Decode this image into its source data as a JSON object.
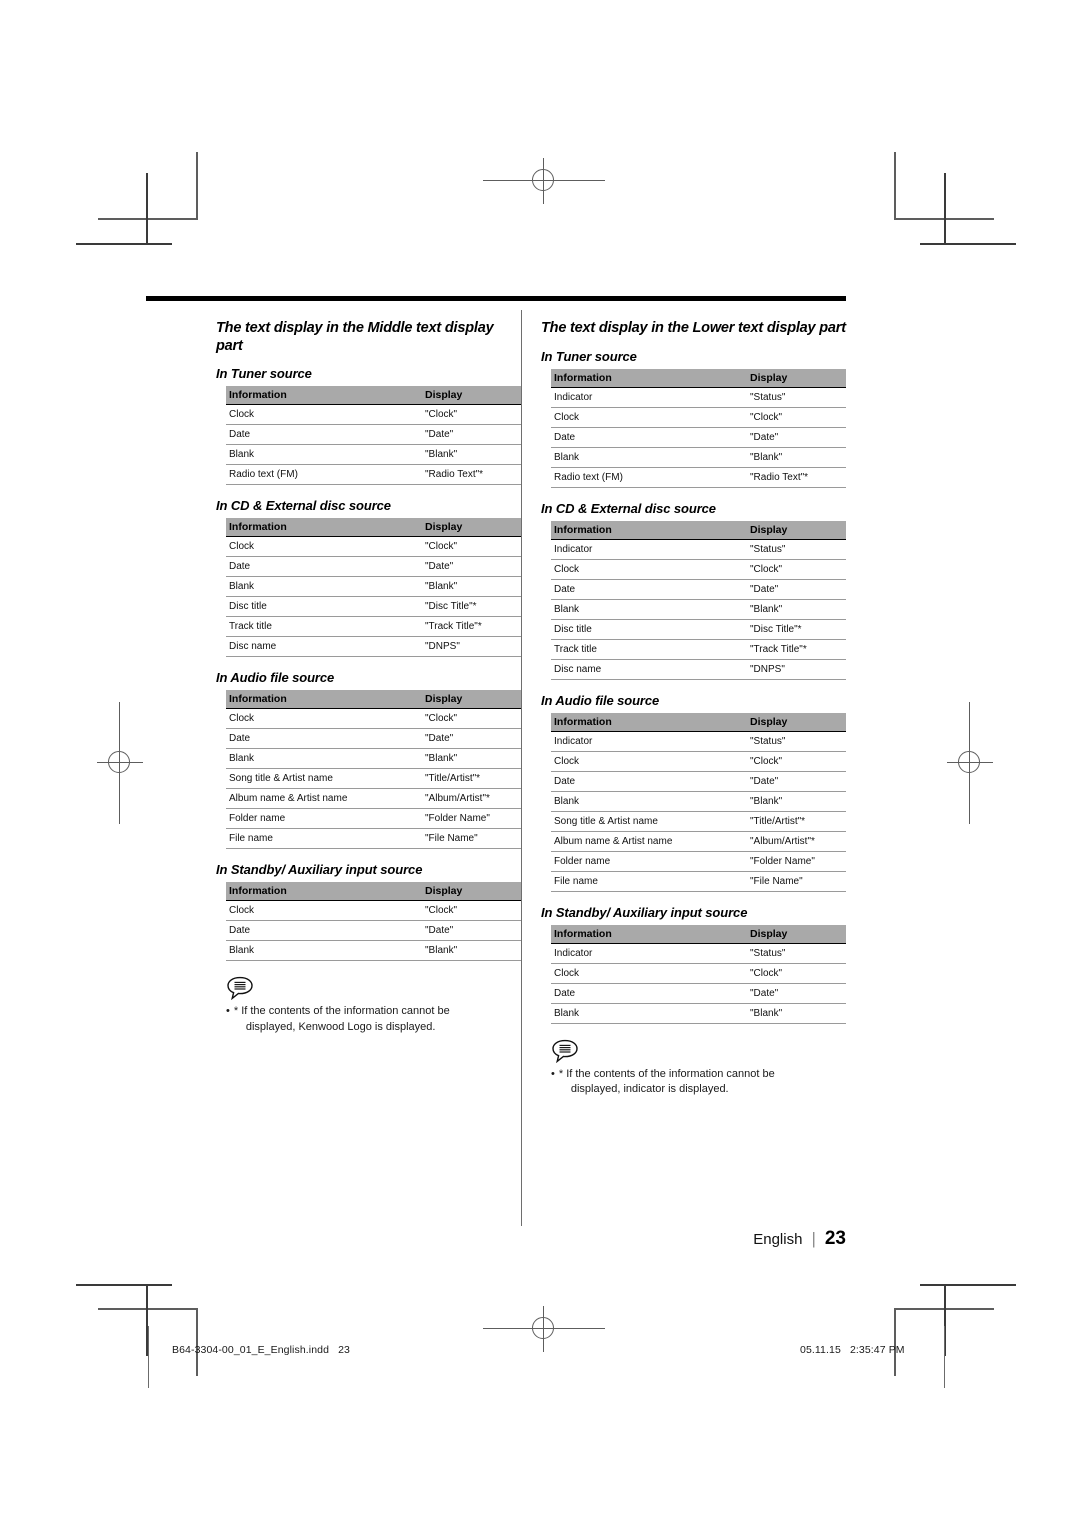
{
  "document": {
    "page_number": "23",
    "language_label": "English",
    "separator": "|"
  },
  "top_rule": true,
  "columns": [
    {
      "id": "middle-text-display",
      "section_title": "The text display in the Middle text display part",
      "blocks": [
        {
          "id": "tuner",
          "heading": "In Tuner source",
          "table": {
            "headers": [
              "Information",
              "Display"
            ],
            "rows": [
              [
                "Clock",
                "\"Clock\""
              ],
              [
                "Date",
                "\"Date\""
              ],
              [
                "Blank",
                "\"Blank\""
              ],
              [
                "Radio text (FM)",
                "\"Radio Text\"*"
              ]
            ]
          }
        },
        {
          "id": "cd-external-disc",
          "heading": "In CD & External disc source",
          "table": {
            "headers": [
              "Information",
              "Display"
            ],
            "rows": [
              [
                "Clock",
                "\"Clock\""
              ],
              [
                "Date",
                "\"Date\""
              ],
              [
                "Blank",
                "\"Blank\""
              ],
              [
                "Disc title",
                "\"Disc Title\"*"
              ],
              [
                "Track title",
                "\"Track Title\"*"
              ],
              [
                "Disc name",
                "\"DNPS\""
              ]
            ]
          }
        },
        {
          "id": "audio-file",
          "heading": "In Audio file source",
          "table": {
            "headers": [
              "Information",
              "Display"
            ],
            "rows": [
              [
                "Clock",
                "\"Clock\""
              ],
              [
                "Date",
                "\"Date\""
              ],
              [
                "Blank",
                "\"Blank\""
              ],
              [
                "Song title & Artist name",
                "\"Title/Artist\"*"
              ],
              [
                "Album name & Artist name",
                "\"Album/Artist\"*"
              ],
              [
                "Folder name",
                "\"Folder Name\""
              ],
              [
                "File name",
                "\"File Name\""
              ]
            ]
          }
        },
        {
          "id": "standby-aux",
          "heading": "In Standby/ Auxiliary input source",
          "table": {
            "headers": [
              "Information",
              "Display"
            ],
            "rows": [
              [
                "Clock",
                "\"Clock\""
              ],
              [
                "Date",
                "\"Date\""
              ],
              [
                "Blank",
                "\"Blank\""
              ]
            ]
          }
        }
      ],
      "note": {
        "icon": "note-balloon-icon",
        "bullet": "•",
        "line1": "* If the contents of the information cannot be",
        "line2": "displayed, Kenwood Logo is displayed."
      }
    },
    {
      "id": "lower-text-display",
      "section_title": "The text display in the Lower text display part",
      "blocks": [
        {
          "id": "tuner",
          "heading": "In Tuner source",
          "table": {
            "headers": [
              "Information",
              "Display"
            ],
            "rows": [
              [
                "Indicator",
                "\"Status\""
              ],
              [
                "Clock",
                "\"Clock\""
              ],
              [
                "Date",
                "\"Date\""
              ],
              [
                "Blank",
                "\"Blank\""
              ],
              [
                "Radio text (FM)",
                "\"Radio Text\"*"
              ]
            ]
          }
        },
        {
          "id": "cd-external-disc",
          "heading": "In CD & External disc source",
          "table": {
            "headers": [
              "Information",
              "Display"
            ],
            "rows": [
              [
                "Indicator",
                "\"Status\""
              ],
              [
                "Clock",
                "\"Clock\""
              ],
              [
                "Date",
                "\"Date\""
              ],
              [
                "Blank",
                "\"Blank\""
              ],
              [
                "Disc title",
                "\"Disc Title\"*"
              ],
              [
                "Track title",
                "\"Track Title\"*"
              ],
              [
                "Disc name",
                "\"DNPS\""
              ]
            ]
          }
        },
        {
          "id": "audio-file",
          "heading": "In Audio file source",
          "table": {
            "headers": [
              "Information",
              "Display"
            ],
            "rows": [
              [
                "Indicator",
                "\"Status\""
              ],
              [
                "Clock",
                "\"Clock\""
              ],
              [
                "Date",
                "\"Date\""
              ],
              [
                "Blank",
                "\"Blank\""
              ],
              [
                "Song title & Artist name",
                "\"Title/Artist\"*"
              ],
              [
                "Album name & Artist name",
                "\"Album/Artist\"*"
              ],
              [
                "Folder name",
                "\"Folder Name\""
              ],
              [
                "File name",
                "\"File Name\""
              ]
            ]
          }
        },
        {
          "id": "standby-aux",
          "heading": "In Standby/ Auxiliary input source",
          "table": {
            "headers": [
              "Information",
              "Display"
            ],
            "rows": [
              [
                "Indicator",
                "\"Status\""
              ],
              [
                "Clock",
                "\"Clock\""
              ],
              [
                "Date",
                "\"Date\""
              ],
              [
                "Blank",
                "\"Blank\""
              ]
            ]
          }
        }
      ],
      "note": {
        "icon": "note-balloon-icon",
        "bullet": "•",
        "line1": "* If the contents of the information cannot be",
        "line2": "displayed, indicator is displayed."
      }
    }
  ],
  "imposition_footer": {
    "file_name": "B64-3304-00_01_E_English.indd",
    "file_page": "23",
    "timestamp": "05.11.15   2:35:47 PM"
  },
  "colors": {
    "table_header_bg": "#a9a9a9",
    "rule": "#000000",
    "row_line": "#9a9a9a",
    "mark": "#5d5d5d"
  }
}
